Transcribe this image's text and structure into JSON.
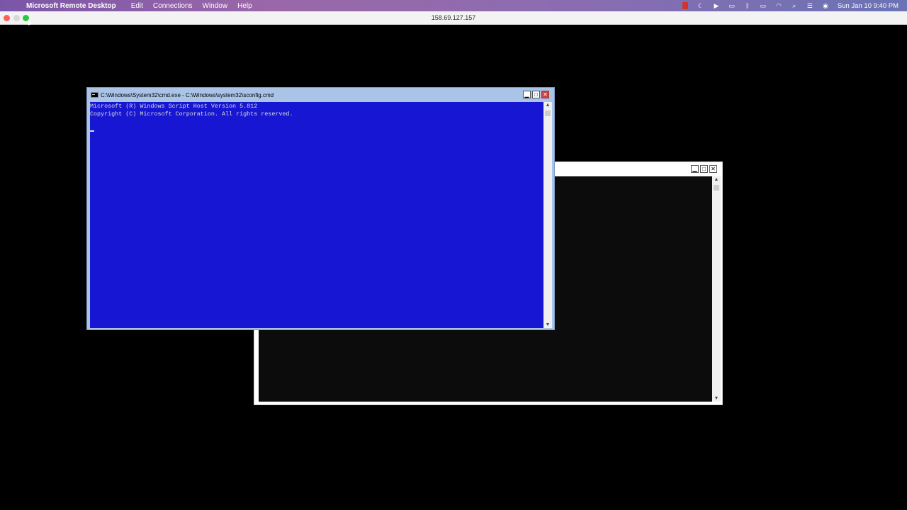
{
  "menubar": {
    "apple_icon": "",
    "app_name": "Microsoft Remote Desktop",
    "menus": [
      "Edit",
      "Connections",
      "Window",
      "Help"
    ],
    "status_icons": [
      "record-icon",
      "moon-icon",
      "play-icon",
      "screen-icon",
      "bluetooth-icon",
      "battery-icon",
      "wifi-icon",
      "search-icon",
      "control-center-icon",
      "siri-icon"
    ],
    "clock": "Sun Jan 10  9:40 PM"
  },
  "window": {
    "title": "158.69.127.157"
  },
  "front_window": {
    "title": "C:\\Windows\\System32\\cmd.exe - C:\\Windows\\system32\\sconfig.cmd",
    "lines": [
      "Microsoft (R) Windows Script Host Version 5.812",
      "Copyright (C) Microsoft Corporation. All rights reserved."
    ],
    "bg_color": "#1717d3",
    "buttons": {
      "minimize": "▁",
      "maximize": "□",
      "close": "✕"
    }
  },
  "back_window": {
    "bg_color": "#0c0c0c",
    "buttons": {
      "minimize": "▁",
      "maximize": "□",
      "close": "✕"
    }
  },
  "scroll": {
    "up": "▲",
    "down": "▼"
  }
}
